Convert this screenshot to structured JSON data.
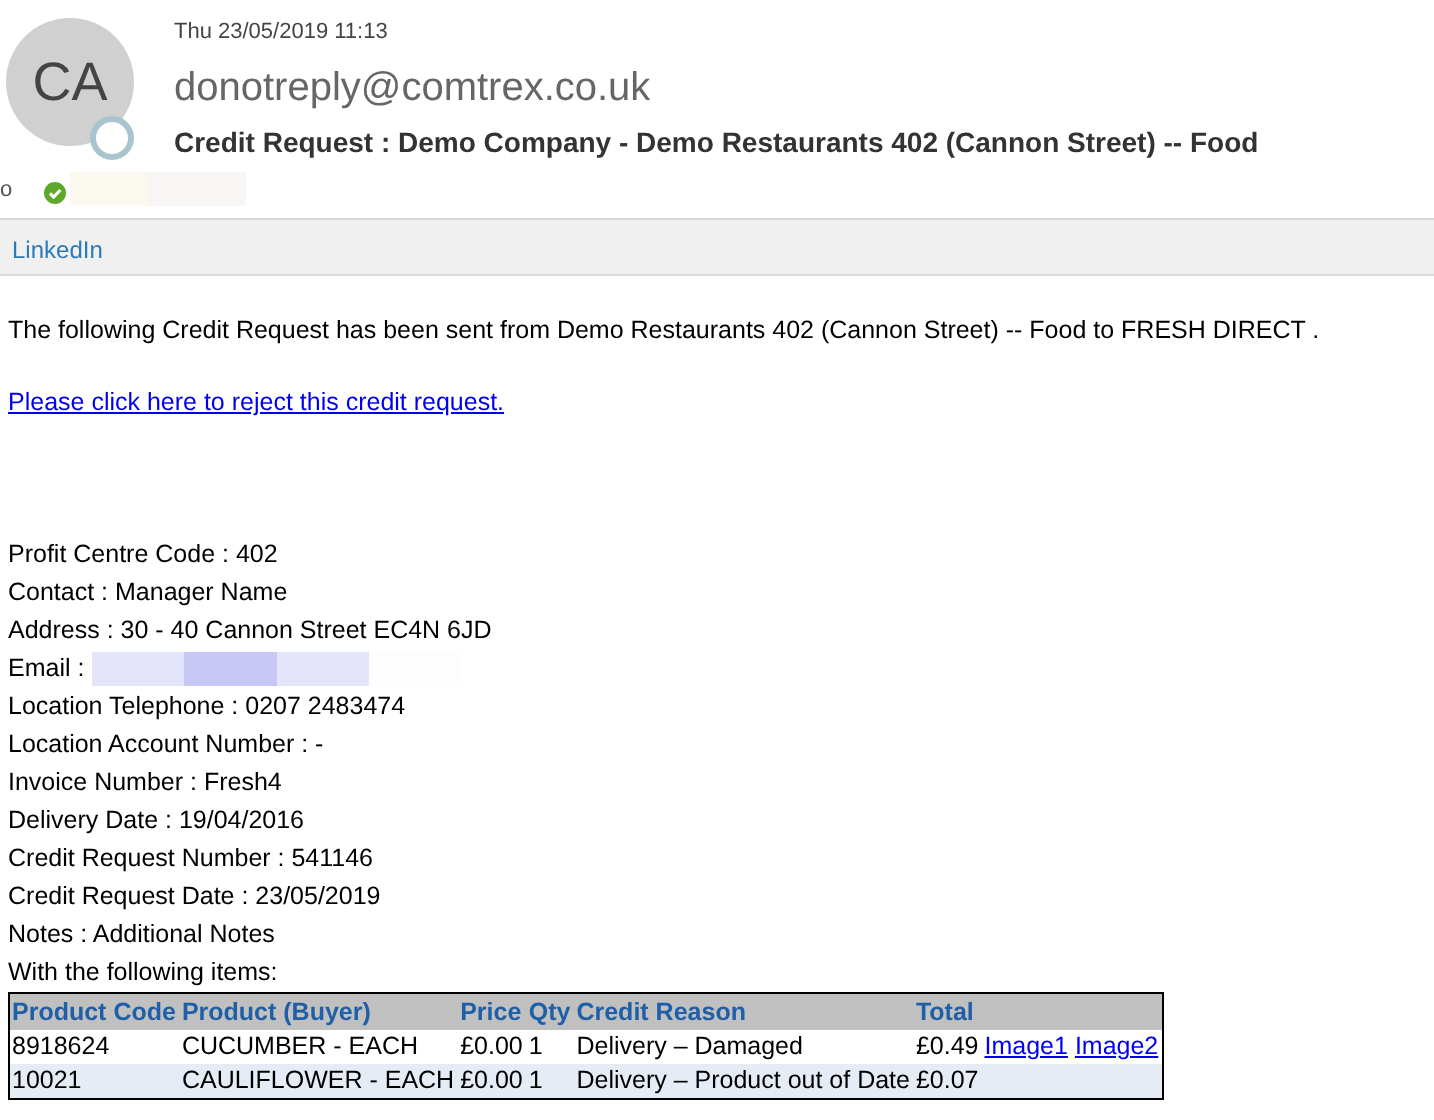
{
  "header": {
    "avatar_initials": "CA",
    "date": "Thu 23/05/2019 11:13",
    "sender": "donotreply@comtrex.co.uk",
    "subject": "Credit Request : Demo Company - Demo Restaurants 402 (Cannon Street) -- Food",
    "to_label": "o",
    "recipient_redacted": true
  },
  "addin_bar": {
    "label": "LinkedIn"
  },
  "body": {
    "intro": "The following Credit Request has been sent from Demo Restaurants 402 (Cannon Street) -- Food to FRESH DIRECT .",
    "reject_link": "Please click here to reject this credit request.",
    "details": [
      {
        "text": "Profit Centre Code : 402",
        "redacted": false
      },
      {
        "text": "Contact : Manager Name",
        "redacted": false
      },
      {
        "text": "Address : 30 - 40 Cannon Street EC4N 6JD",
        "redacted": false
      },
      {
        "text": "Email :",
        "redacted": true
      },
      {
        "text": "Location Telephone : 0207 2483474",
        "redacted": false
      },
      {
        "text": "Location Account Number : -",
        "redacted": false
      },
      {
        "text": "Invoice Number : Fresh4",
        "redacted": false
      },
      {
        "text": "Delivery Date : 19/04/2016",
        "redacted": false
      },
      {
        "text": "Credit Request Number : 541146",
        "redacted": false
      },
      {
        "text": "Credit Request Date : 23/05/2019",
        "redacted": false
      },
      {
        "text": "Notes : Additional Notes",
        "redacted": false
      }
    ],
    "items_label": "With the following items:",
    "table": {
      "columns": [
        "Product Code",
        "Product (Buyer)",
        "Price",
        "Qty",
        "Credit Reason",
        "Total"
      ],
      "rows": [
        {
          "cells": [
            "8918624",
            "CUCUMBER - EACH",
            "£0.00",
            "1",
            "Delivery – Damaged",
            "£0.49"
          ],
          "links": [
            "Image1",
            "Image2"
          ]
        },
        {
          "cells": [
            "10021",
            "CAULIFLOWER - EACH",
            "£0.00",
            "1",
            "Delivery – Product out of Date",
            "£0.07"
          ],
          "links": []
        }
      ]
    }
  }
}
